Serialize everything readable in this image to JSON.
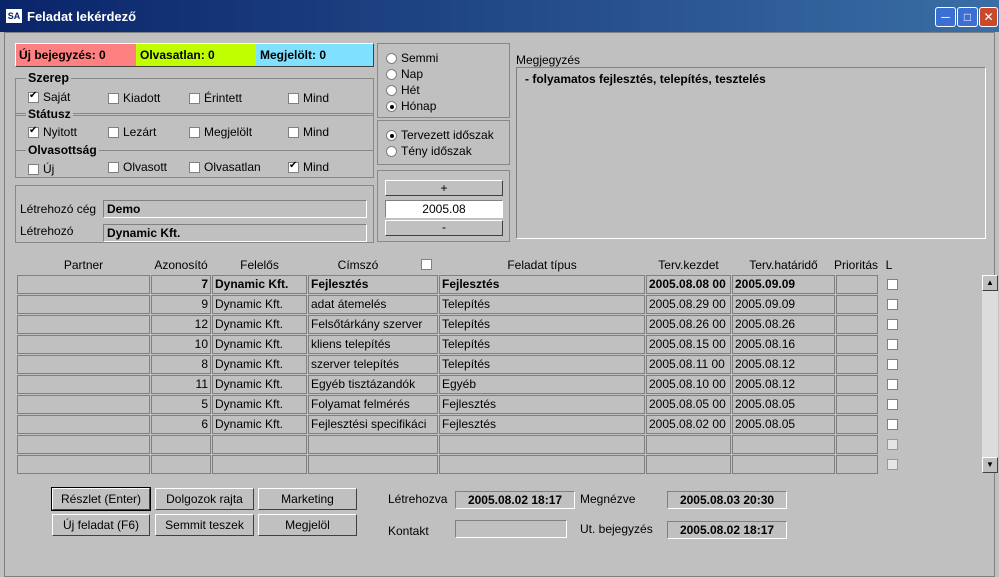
{
  "title": "Feladat lekérdező",
  "app_icon_text": "SA",
  "counters": {
    "uj": "Új bejegyzés: 0",
    "olvasatlan": "Olvasatlan: 0",
    "megjelolt": "Megjelölt: 0",
    "colors": {
      "uj": "#ff8080",
      "olvasatlan": "#c0ff00",
      "megjelolt": "#80e0ff"
    }
  },
  "szerep": {
    "label": "Szerep",
    "options": [
      {
        "label": "Saját",
        "checked": true
      },
      {
        "label": "Kiadott",
        "checked": false
      },
      {
        "label": "Érintett",
        "checked": false
      },
      {
        "label": "Mind",
        "checked": false
      }
    ]
  },
  "statusz": {
    "label": "Státusz",
    "options": [
      {
        "label": "Nyitott",
        "checked": true
      },
      {
        "label": "Lezárt",
        "checked": false
      },
      {
        "label": "Megjelölt",
        "checked": false
      },
      {
        "label": "Mind",
        "checked": false
      }
    ]
  },
  "olvasottsag": {
    "label": "Olvasottság",
    "options": [
      {
        "label": "Új",
        "checked": false
      },
      {
        "label": "Olvasott",
        "checked": false
      },
      {
        "label": "Olvasatlan",
        "checked": false
      },
      {
        "label": "Mind",
        "checked": true
      }
    ]
  },
  "period": {
    "options": [
      {
        "label": "Semmi",
        "selected": false
      },
      {
        "label": "Nap",
        "selected": false
      },
      {
        "label": "Hét",
        "selected": false
      },
      {
        "label": "Hónap",
        "selected": true
      }
    ],
    "type_options": [
      {
        "label": "Tervezett időszak",
        "selected": true
      },
      {
        "label": "Tény időszak",
        "selected": false
      }
    ],
    "plus": "+",
    "value": "2005.08",
    "minus": "-"
  },
  "creator": {
    "ceg_label": "Létrehozó cég",
    "ceg_value": "Demo",
    "label": "Létrehozó",
    "value": "Dynamic Kft."
  },
  "note": {
    "label": "Megjegyzés",
    "text": "- folyamatos fejlesztés, telepítés, tesztelés"
  },
  "table": {
    "headers": [
      "Partner",
      "Azonosító",
      "Felelős",
      "Címszó",
      "Feladat típus",
      "Terv.kezdet",
      "Terv.határidő",
      "Prioritás",
      "L"
    ],
    "rows": [
      [
        "",
        "7",
        "Dynamic Kft.",
        "Fejlesztés",
        "Fejlesztés",
        "2005.08.08 00",
        "2005.09.09",
        ""
      ],
      [
        "",
        "9",
        "Dynamic Kft.",
        "adat átemelés",
        "Telepítés",
        "2005.08.29 00",
        "2005.09.09",
        ""
      ],
      [
        "",
        "12",
        "Dynamic Kft.",
        "Felsőtárkány szerver",
        "Telepítés",
        "2005.08.26 00",
        "2005.08.26",
        ""
      ],
      [
        "",
        "10",
        "Dynamic Kft.",
        "kliens telepítés",
        "Telepítés",
        "2005.08.15 00",
        "2005.08.16",
        ""
      ],
      [
        "",
        "8",
        "Dynamic Kft.",
        "szerver telepítés",
        "Telepítés",
        "2005.08.11 00",
        "2005.08.12",
        ""
      ],
      [
        "",
        "11",
        "Dynamic Kft.",
        "Egyéb tisztázandók",
        "Egyéb",
        "2005.08.10 00",
        "2005.08.12",
        ""
      ],
      [
        "",
        "5",
        "Dynamic Kft.",
        "Folyamat felmérés",
        "Fejlesztés",
        "2005.08.05 00",
        "2005.08.05",
        ""
      ],
      [
        "",
        "6",
        "Dynamic Kft.",
        "Fejlesztési specifikáci",
        "Fejlesztés",
        "2005.08.02 00",
        "2005.08.05",
        ""
      ],
      [
        "",
        "",
        "",
        "",
        "",
        "",
        "",
        ""
      ],
      [
        "",
        "",
        "",
        "",
        "",
        "",
        "",
        ""
      ]
    ]
  },
  "buttons": {
    "reszlet": "Részlet (Enter)",
    "dolgozok": "Dolgozok rajta",
    "marketing": "Marketing",
    "uj_feladat": "Új feladat (F6)",
    "semmit": "Semmit teszek",
    "megjelol": "Megjelöl"
  },
  "footer": {
    "letrehozva_label": "Létrehozva",
    "letrehozva_value": "2005.08.02 18:17",
    "megnezve_label": "Megnézve",
    "megnezve_value": "2005.08.03 20:30",
    "kontakt_label": "Kontakt",
    "kontakt_value": "",
    "ut_label": "Ut. bejegyzés",
    "ut_value": "2005.08.02 18:17"
  }
}
